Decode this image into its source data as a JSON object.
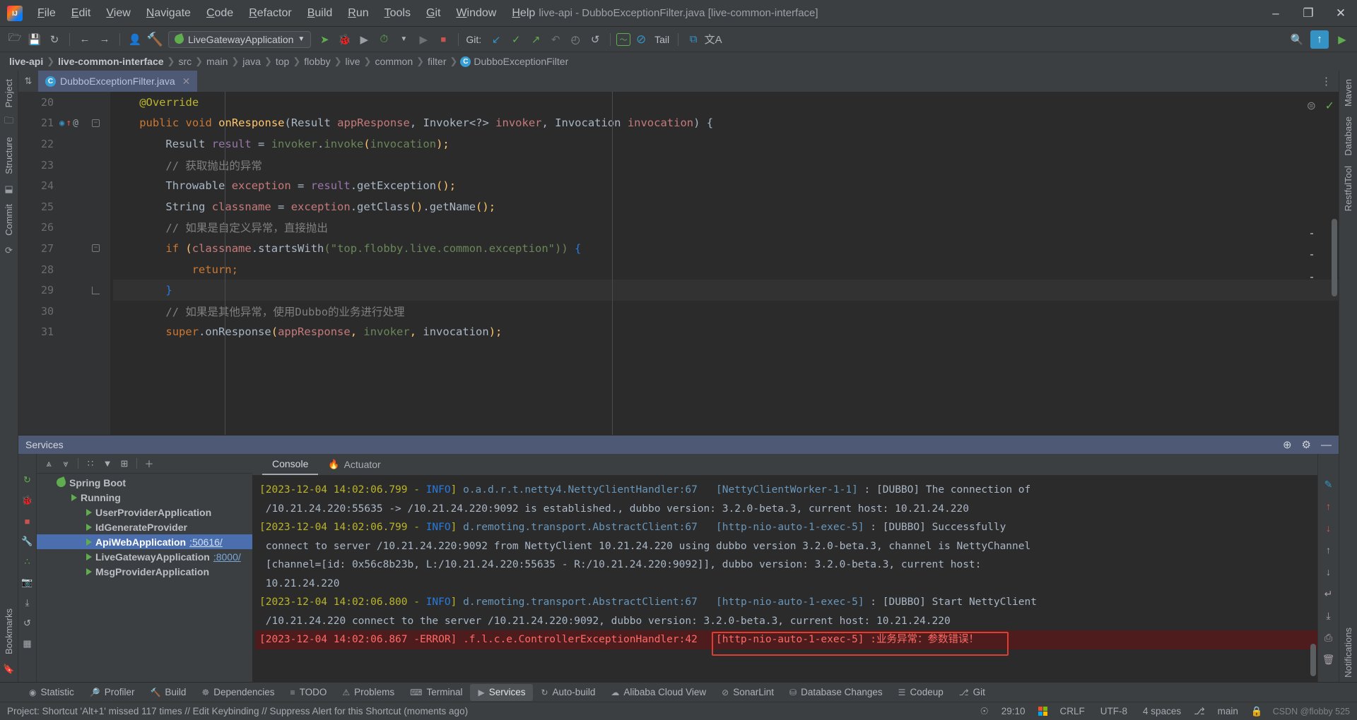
{
  "window": {
    "title": "live-api - DubboExceptionFilter.java [live-common-interface]",
    "controls": {
      "minimize": "–",
      "maximize": "❐",
      "close": "✕"
    }
  },
  "menu": [
    {
      "label": "File"
    },
    {
      "label": "Edit"
    },
    {
      "label": "View"
    },
    {
      "label": "Navigate"
    },
    {
      "label": "Code"
    },
    {
      "label": "Refactor"
    },
    {
      "label": "Build"
    },
    {
      "label": "Run"
    },
    {
      "label": "Tools"
    },
    {
      "label": "Git"
    },
    {
      "label": "Window"
    },
    {
      "label": "Help"
    }
  ],
  "toolbar": {
    "open_label": "🗁",
    "save_label": "💾",
    "sync_label": "↻",
    "back_label": "←",
    "forward_label": "→",
    "profile_label": "👤",
    "build_label": "🔨",
    "run_config": "LiveGatewayApplication",
    "run_label": "➤",
    "debug_label": "🐞",
    "coverage_label": "▶",
    "profiler_label": "⏱",
    "stop_label": "■",
    "git_label": "Git:",
    "git_update": "↙",
    "git_commit": "✓",
    "git_push": "↗",
    "git_rollback": "↶",
    "git_history": "◴",
    "git_revert": "↺",
    "chart_label": "〜",
    "noentry_label": "⊘",
    "tail_label": "Tail",
    "copy_label": "⧉",
    "translate_label": "文A",
    "search_label": "🔍",
    "updates_label": "↑",
    "play_label": "▶"
  },
  "breadcrumb": {
    "items": [
      {
        "label": "live-api",
        "bold": true
      },
      {
        "label": "live-common-interface",
        "bold": true
      },
      {
        "label": "src",
        "bold": false
      },
      {
        "label": "main",
        "bold": false
      },
      {
        "label": "java",
        "bold": false
      },
      {
        "label": "top",
        "bold": false
      },
      {
        "label": "flobby",
        "bold": false
      },
      {
        "label": "live",
        "bold": false
      },
      {
        "label": "common",
        "bold": false
      },
      {
        "label": "filter",
        "bold": false
      }
    ],
    "separator": "❯",
    "class_badge": "C",
    "class_name": "DubboExceptionFilter"
  },
  "editor_tabs": [
    {
      "badge": "C",
      "label": "DubboExceptionFilter.java",
      "close": "✕",
      "active": true
    }
  ],
  "editor": {
    "lines": [
      {
        "num": "20",
        "indent": 4,
        "tokens": [
          {
            "t": "t-ann",
            "v": "@Override"
          }
        ]
      },
      {
        "num": "21",
        "indent": 4,
        "marks": [
          "override",
          "up",
          "at"
        ],
        "fold": "start",
        "tokens": [
          {
            "t": "t-kw",
            "v": "public void "
          },
          {
            "t": "t-mth",
            "v": "onResponse"
          },
          {
            "t": "t-typ",
            "v": "("
          },
          {
            "t": "t-typ",
            "v": "Result "
          },
          {
            "t": "t-par",
            "v": "appResponse"
          },
          {
            "t": "t-typ",
            "v": ", "
          },
          {
            "t": "t-typ",
            "v": "Invoker<?> "
          },
          {
            "t": "t-par",
            "v": "invoker"
          },
          {
            "t": "t-typ",
            "v": ", "
          },
          {
            "t": "t-typ",
            "v": "Invocation "
          },
          {
            "t": "t-par",
            "v": "invocation"
          },
          {
            "t": "t-typ",
            "v": ") {"
          }
        ]
      },
      {
        "num": "22",
        "indent": 8,
        "tokens": [
          {
            "t": "t-typ",
            "v": "Result "
          },
          {
            "t": "t-fld",
            "v": "result"
          },
          {
            "t": "t-typ",
            "v": " = "
          },
          {
            "t": "t-grn",
            "v": "invoker"
          },
          {
            "t": "t-typ",
            "v": "."
          },
          {
            "t": "t-grn",
            "v": "invoke"
          },
          {
            "t": "t-mth",
            "v": "("
          },
          {
            "t": "t-grn",
            "v": "invocation"
          },
          {
            "t": "t-mth",
            "v": ");"
          }
        ]
      },
      {
        "num": "23",
        "indent": 8,
        "tokens": [
          {
            "t": "t-cmt",
            "v": "// 获取抛出的异常"
          }
        ]
      },
      {
        "num": "24",
        "indent": 8,
        "tokens": [
          {
            "t": "t-typ",
            "v": "Throwable "
          },
          {
            "t": "t-par",
            "v": "exception"
          },
          {
            "t": "t-typ",
            "v": " = "
          },
          {
            "t": "t-fld",
            "v": "result"
          },
          {
            "t": "t-typ",
            "v": ".getException"
          },
          {
            "t": "t-mth",
            "v": "();"
          }
        ]
      },
      {
        "num": "25",
        "indent": 8,
        "tokens": [
          {
            "t": "t-typ",
            "v": "String "
          },
          {
            "t": "t-par",
            "v": "classname"
          },
          {
            "t": "t-typ",
            "v": " = "
          },
          {
            "t": "t-par",
            "v": "exception"
          },
          {
            "t": "t-typ",
            "v": ".getClass"
          },
          {
            "t": "t-mth",
            "v": "()"
          },
          {
            "t": "t-typ",
            "v": ".getName"
          },
          {
            "t": "t-mth",
            "v": "();"
          }
        ]
      },
      {
        "num": "26",
        "indent": 8,
        "tokens": [
          {
            "t": "t-cmt",
            "v": "// 如果是自定义异常，直接抛出"
          }
        ]
      },
      {
        "num": "27",
        "indent": 8,
        "fold": "start",
        "tokens": [
          {
            "t": "t-kw",
            "v": "if "
          },
          {
            "t": "t-mth",
            "v": "("
          },
          {
            "t": "t-par",
            "v": "classname"
          },
          {
            "t": "t-typ",
            "v": ".startsWith"
          },
          {
            "t": "t-grn",
            "v": "("
          },
          {
            "t": "t-str",
            "v": "\"top.flobby.live.common.exception\""
          },
          {
            "t": "t-grn",
            "v": "))"
          },
          {
            "t": "t-blu",
            "v": " {"
          }
        ]
      },
      {
        "num": "28",
        "indent": 12,
        "tokens": [
          {
            "t": "t-kw",
            "v": "return;"
          }
        ]
      },
      {
        "num": "29",
        "indent": 8,
        "hl": true,
        "fold": "end",
        "tokens": [
          {
            "t": "t-blu",
            "v": "}"
          }
        ]
      },
      {
        "num": "30",
        "indent": 8,
        "tokens": [
          {
            "t": "t-cmt",
            "v": "// 如果是其他异常，使用Dubbo的业务进行处理"
          }
        ]
      },
      {
        "num": "31",
        "indent": 8,
        "tokens": [
          {
            "t": "t-kw",
            "v": "super"
          },
          {
            "t": "t-typ",
            "v": ".onResponse"
          },
          {
            "t": "t-mth",
            "v": "("
          },
          {
            "t": "t-par",
            "v": "appResponse"
          },
          {
            "t": "t-mth",
            "v": ", "
          },
          {
            "t": "t-grn",
            "v": "invoker"
          },
          {
            "t": "t-mth",
            "v": ", "
          },
          {
            "t": "t-typ",
            "v": "invocation"
          },
          {
            "t": "t-mth",
            "v": ");"
          }
        ]
      }
    ]
  },
  "left_strip": {
    "project_label": "Project",
    "structure_label": "Structure",
    "commit_label": "Commit",
    "bookmarks_label": "Bookmarks"
  },
  "right_strip": {
    "maven_label": "Maven",
    "database_label": "Database",
    "restful_label": "RestfulTool",
    "notifications_label": "Notifications"
  },
  "services": {
    "title": "Services",
    "header_icons": {
      "settings": "⚙",
      "help": "⊕",
      "minimize": "—"
    },
    "left_tools": [
      {
        "name": "rerun",
        "glyph": "↻"
      },
      {
        "name": "debug",
        "glyph": "🐞"
      },
      {
        "name": "stop",
        "glyph": "■"
      },
      {
        "name": "settings",
        "glyph": "🔧"
      },
      {
        "name": "threads",
        "glyph": "∴"
      },
      {
        "name": "camera",
        "glyph": "📷"
      },
      {
        "name": "export",
        "glyph": "⤓"
      },
      {
        "name": "refresh",
        "glyph": "↺"
      },
      {
        "name": "grid",
        "glyph": "▦"
      }
    ],
    "tree_toolbar": [
      {
        "name": "expand-all",
        "glyph": "⩓"
      },
      {
        "name": "collapse-all",
        "glyph": "⩔"
      },
      {
        "name": "group-by",
        "glyph": "∷"
      },
      {
        "name": "filter",
        "glyph": "▼"
      },
      {
        "name": "add-tab",
        "glyph": "⊞"
      },
      {
        "name": "add-service",
        "glyph": "＋"
      }
    ],
    "tree": [
      {
        "depth": 0,
        "chev": "ⱟ",
        "icon": "spring",
        "label": "Spring Boot",
        "port": "",
        "selected": false
      },
      {
        "depth": 1,
        "chev": "ⱟ",
        "icon": "run",
        "label": "Running",
        "port": "",
        "selected": false
      },
      {
        "depth": 2,
        "chev": "",
        "icon": "run",
        "label": "UserProviderApplication",
        "port": "",
        "selected": false
      },
      {
        "depth": 2,
        "chev": "",
        "icon": "run",
        "label": "IdGenerateProvider",
        "port": "",
        "selected": false
      },
      {
        "depth": 2,
        "chev": "",
        "icon": "run",
        "label": "ApiWebApplication",
        "port": ":50616/",
        "selected": true
      },
      {
        "depth": 2,
        "chev": "",
        "icon": "run",
        "label": "LiveGatewayApplication",
        "port": ":8000/",
        "selected": false
      },
      {
        "depth": 2,
        "chev": "",
        "icon": "run",
        "label": "MsgProviderApplication",
        "port": "",
        "selected": false
      }
    ],
    "console_tabs": [
      {
        "label": "Console",
        "active": true,
        "icon": ""
      },
      {
        "label": "Actuator",
        "active": false,
        "icon": "flame"
      }
    ],
    "console_lines": [
      {
        "error": false,
        "segs": [
          {
            "c": "c-time",
            "v": "[2023-12-04 14:02:06.799 - "
          },
          {
            "c": "c-info",
            "v": "INFO"
          },
          {
            "c": "c-time",
            "v": "] "
          },
          {
            "c": "c-logger",
            "v": "o.a.d.r.t.netty4.NettyClientHandler:67"
          },
          {
            "c": "c-txt",
            "v": "   "
          },
          {
            "c": "c-logger",
            "v": "[NettyClientWorker-1-1]"
          },
          {
            "c": "c-txt",
            "v": " : [DUBBO] The connection of"
          }
        ]
      },
      {
        "error": false,
        "segs": [
          {
            "c": "c-txt",
            "v": " /10.21.24.220:55635 -> /10.21.24.220:9092 is established., dubbo version: 3.2.0-beta.3, current host: 10.21.24.220"
          }
        ]
      },
      {
        "error": false,
        "segs": [
          {
            "c": "c-time",
            "v": "[2023-12-04 14:02:06.799 - "
          },
          {
            "c": "c-info",
            "v": "INFO"
          },
          {
            "c": "c-time",
            "v": "] "
          },
          {
            "c": "c-logger",
            "v": "d.remoting.transport.AbstractClient:67"
          },
          {
            "c": "c-txt",
            "v": "   "
          },
          {
            "c": "c-logger",
            "v": "[http-nio-auto-1-exec-5]"
          },
          {
            "c": "c-txt",
            "v": " : [DUBBO] Successfully"
          }
        ]
      },
      {
        "error": false,
        "segs": [
          {
            "c": "c-txt",
            "v": " connect to server /10.21.24.220:9092 from NettyClient 10.21.24.220 using dubbo version 3.2.0-beta.3, channel is NettyChannel"
          }
        ]
      },
      {
        "error": false,
        "segs": [
          {
            "c": "c-txt",
            "v": " [channel=[id: 0x56c8b23b, L:/10.21.24.220:55635 - R:/10.21.24.220:9092]], dubbo version: 3.2.0-beta.3, current host:"
          }
        ]
      },
      {
        "error": false,
        "segs": [
          {
            "c": "c-txt",
            "v": " 10.21.24.220"
          }
        ]
      },
      {
        "error": false,
        "segs": [
          {
            "c": "c-time",
            "v": "[2023-12-04 14:02:06.800 - "
          },
          {
            "c": "c-info",
            "v": "INFO"
          },
          {
            "c": "c-time",
            "v": "] "
          },
          {
            "c": "c-logger",
            "v": "d.remoting.transport.AbstractClient:67"
          },
          {
            "c": "c-txt",
            "v": "   "
          },
          {
            "c": "c-logger",
            "v": "[http-nio-auto-1-exec-5]"
          },
          {
            "c": "c-txt",
            "v": " : [DUBBO] Start NettyClient"
          }
        ]
      },
      {
        "error": false,
        "segs": [
          {
            "c": "c-txt",
            "v": " /10.21.24.220 connect to the server /10.21.24.220:9092, dubbo version: 3.2.0-beta.3, current host: 10.21.24.220"
          }
        ]
      },
      {
        "error": true,
        "segs": [
          {
            "c": "c-err",
            "v": "[2023-12-04 14:02:06.867 -ERROR] .f.l.c.e.ControllerExceptionHandler:42   [http-nio-auto-1-exec-5] :业务异常：参数错误！"
          }
        ]
      }
    ],
    "console_right_icons": [
      {
        "name": "edit",
        "glyph": "✎"
      },
      {
        "name": "up-error",
        "glyph": "↑"
      },
      {
        "name": "down-error",
        "glyph": "↓"
      },
      {
        "name": "scroll-up",
        "glyph": "↑"
      },
      {
        "name": "scroll-down",
        "glyph": "↓"
      },
      {
        "name": "soft-wrap",
        "glyph": "↵"
      },
      {
        "name": "scroll-end",
        "glyph": "⤓"
      },
      {
        "name": "print",
        "glyph": "⎙"
      },
      {
        "name": "clear-all",
        "glyph": "🗑"
      }
    ]
  },
  "tool_windows": [
    {
      "label": "Statistic",
      "icon": "◉",
      "active": false
    },
    {
      "label": "Profiler",
      "icon": "🔎",
      "active": false
    },
    {
      "label": "Build",
      "icon": "🔨",
      "active": false
    },
    {
      "label": "Dependencies",
      "icon": "☸",
      "active": false
    },
    {
      "label": "TODO",
      "icon": "≡",
      "active": false
    },
    {
      "label": "Problems",
      "icon": "⚠",
      "active": false
    },
    {
      "label": "Terminal",
      "icon": "⌨",
      "active": false
    },
    {
      "label": "Services",
      "icon": "▶",
      "active": true
    },
    {
      "label": "Auto-build",
      "icon": "↻",
      "active": false
    },
    {
      "label": "Alibaba Cloud View",
      "icon": "☁",
      "active": false
    },
    {
      "label": "SonarLint",
      "icon": "⊘",
      "active": false
    },
    {
      "label": "Database Changes",
      "icon": "⛁",
      "active": false
    },
    {
      "label": "Codeup",
      "icon": "☰",
      "active": false
    },
    {
      "label": "Git",
      "icon": "⎇",
      "active": false
    }
  ],
  "statusbar": {
    "message": "Project: Shortcut 'Alt+1' missed 117 times // Edit Keybinding // Suppress Alert for this Shortcut (moments ago)",
    "caret": "29:10",
    "line_sep": "CRLF",
    "encoding": "UTF-8",
    "indent": "4 spaces",
    "branch": "main",
    "branch_icon": "⎇",
    "lock_icon": "🔒",
    "inspect_icon": "☉",
    "watermark": "CSDN @flobby 525"
  }
}
